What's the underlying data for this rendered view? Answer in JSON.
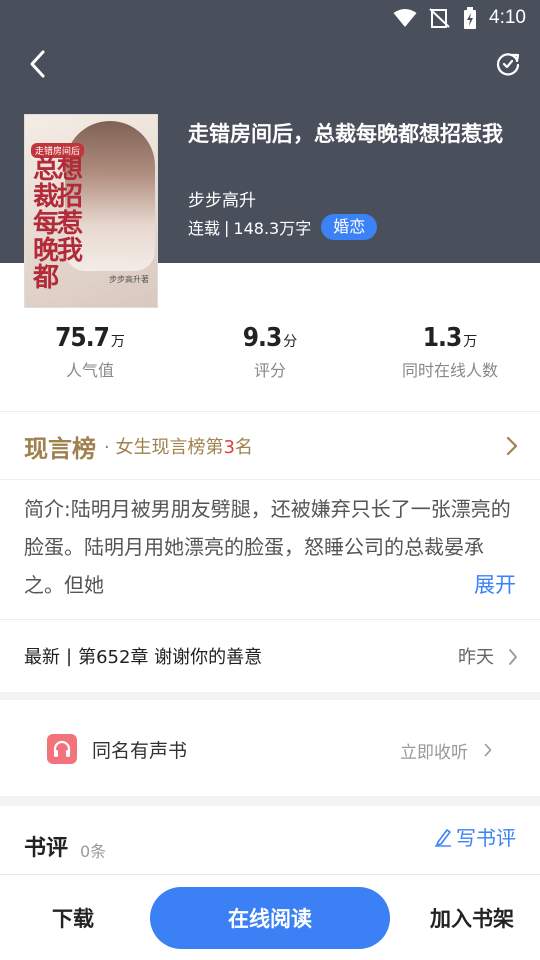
{
  "status_bar": {
    "time": "4:10"
  },
  "header": {
    "back_icon": "chevron-left-icon",
    "refresh_icon": "refresh-icon"
  },
  "book": {
    "title": "走错房间后，总裁每晚都想招惹我",
    "author": "步步高升",
    "status": "连载",
    "separator": "|",
    "word_count": "148.3万字",
    "genre": "婚恋",
    "cover": {
      "badge": "走错房间后",
      "title": "总想裁招每惹晚我都",
      "author": "步步高升",
      "author_suffix": "著"
    }
  },
  "stats": [
    {
      "value": "75.7",
      "unit": "万",
      "label": "人气值"
    },
    {
      "value": "9.3",
      "unit": "分",
      "label": "评分"
    },
    {
      "value": "1.3",
      "unit": "万",
      "label": "同时在线人数"
    }
  ],
  "rank": {
    "name": "现言榜",
    "dot": "·",
    "detail_prefix": "女生现言榜第",
    "position": "3",
    "detail_suffix": "名"
  },
  "intro": {
    "text": "简介:陆明月被男朋友劈腿，还被嫌弃只长了一张漂亮的脸蛋。陆明月用她漂亮的脸蛋，怒睡公司的总裁晏承之。但她",
    "expand": "展开"
  },
  "latest": {
    "label": "最新",
    "separator": "|",
    "chapter": "第652章 谢谢你的善意",
    "time": "昨天"
  },
  "audio": {
    "label": "同名有声书",
    "action": "立即收听",
    "icon": "headphones-icon"
  },
  "reviews": {
    "title": "书评",
    "count": "0条",
    "write": "写书评",
    "write_icon": "pen-icon"
  },
  "bottom_bar": {
    "download": "下载",
    "read_online": "在线阅读",
    "add_shelf": "加入书架"
  },
  "colors": {
    "header_bg": "#4a4f5c",
    "accent_blue": "#3c80f5",
    "rank_gold": "#a0804f",
    "rank_red": "#e23d3d",
    "audio_pink": "#f4727c"
  }
}
